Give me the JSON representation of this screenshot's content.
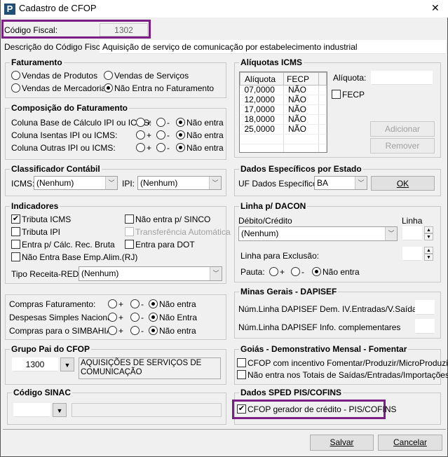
{
  "window": {
    "title": "Cadastro de CFOP",
    "logo": "P",
    "close": "✕"
  },
  "codigo_fiscal": {
    "label": "Código Fiscal:",
    "value": "1302"
  },
  "descricao": {
    "label": "Descrição do Código Fiscal:",
    "value": "Aquisição de serviço de comunicação por estabelecimento industrial"
  },
  "faturamento": {
    "title": "Faturamento",
    "options": [
      "Vendas de Produtos",
      "Vendas de Serviços",
      "Vendas de Mercadorias",
      "Não Entra no Faturamento"
    ],
    "selected": "Não Entra no Faturamento"
  },
  "composicao": {
    "title": "Composição do Faturamento",
    "rows": [
      "Coluna Base de Cálculo IPI ou ICMS:",
      "Coluna Isentas IPI ou ICMS:",
      "Coluna Outras IPI ou ICMS:"
    ],
    "plus": "+",
    "minus": "-",
    "none": "Não entra"
  },
  "aliquotas": {
    "title": "Alíquotas ICMS",
    "columns": [
      "Alíquota",
      "FECP"
    ],
    "rows": [
      [
        "07,0000",
        "NÃO"
      ],
      [
        "12,0000",
        "NÃO"
      ],
      [
        "17,0000",
        "NÃO"
      ],
      [
        "18,0000",
        "NÃO"
      ],
      [
        "25,0000",
        "NÃO"
      ]
    ],
    "aliquota_label": "Alíquota:",
    "aliquota_value": "",
    "fecp_label": "FECP",
    "add": "Adicionar",
    "remove": "Remover"
  },
  "dados_estado": {
    "title": "Dados Específicos por Estado",
    "uf_label": "UF Dados Específicos:",
    "uf_value": "BA",
    "ok": "OK"
  },
  "classificador": {
    "title": "Classificador Contábil",
    "icms_label": "ICMS:",
    "icms_value": "(Nenhum)",
    "ipi_label": "IPI:",
    "ipi_value": "(Nenhum)"
  },
  "dacon": {
    "title": "Linha p/ DACON",
    "debito_label": "Débito/Crédito",
    "debito_value": "(Nenhum)",
    "linha_label": "Linha",
    "exclusao_label": "Linha para Exclusão:",
    "pauta_label": "Pauta:",
    "plus": "+",
    "minus": "-",
    "none": "Não entra"
  },
  "indicadores": {
    "title": "Indicadores",
    "checks": [
      {
        "label": "Tributa ICMS",
        "checked": true
      },
      {
        "label": "Não entra p/ SINCO",
        "checked": false
      },
      {
        "label": "Tributa IPI",
        "checked": false
      },
      {
        "label": "Transferência Automática",
        "checked": false,
        "disabled": true
      },
      {
        "label": "Entra p/ Cálc. Rec. Bruta",
        "checked": false
      },
      {
        "label": "Entra para DOT",
        "checked": false
      },
      {
        "label": "Não Entra Base Emp.Alim.(RJ)",
        "checked": false
      }
    ],
    "tipo_label": "Tipo Receita-REDF:",
    "tipo_value": "(Nenhum)"
  },
  "compras": {
    "rows": [
      {
        "label": "Compras Faturamento:",
        "none": "Não entra"
      },
      {
        "label": "Despesas Simples Nacional:",
        "none": "Não Entra"
      },
      {
        "label": "Compras para o SIMBAHIA:",
        "none": "Não entra"
      }
    ],
    "plus": "+",
    "minus": "-"
  },
  "minas": {
    "title": "Minas Gerais - DAPISEF",
    "rows": [
      "Núm.Linha DAPISEF Dem. IV.Entradas/V.Saídas",
      "Núm.Linha DAPISEF Info. complementares"
    ]
  },
  "grupo_pai": {
    "title": "Grupo Pai do CFOP",
    "code": "1300",
    "description": "AQUISIÇÕES DE SERVIÇOS DE COMUNICAÇÃO"
  },
  "goias": {
    "title": "Goiás - Demonstrativo Mensal - Fomentar",
    "checks": [
      "CFOP com incentivo  Fomentar/Produzir/MicroProduzir",
      "Não entra nos Totais de  Saídas/Entradas/Importações"
    ]
  },
  "sinac": {
    "title": "Código SINAC",
    "code": "",
    "description": ""
  },
  "sped": {
    "title": "Dados SPED PIS/COFINS",
    "check_label": "CFOP gerador de crédito - PIS/COFINS",
    "checked": true
  },
  "buttons": {
    "save": "Salvar",
    "cancel": "Cancelar"
  },
  "colors": {
    "highlight": "#7b1f86"
  }
}
